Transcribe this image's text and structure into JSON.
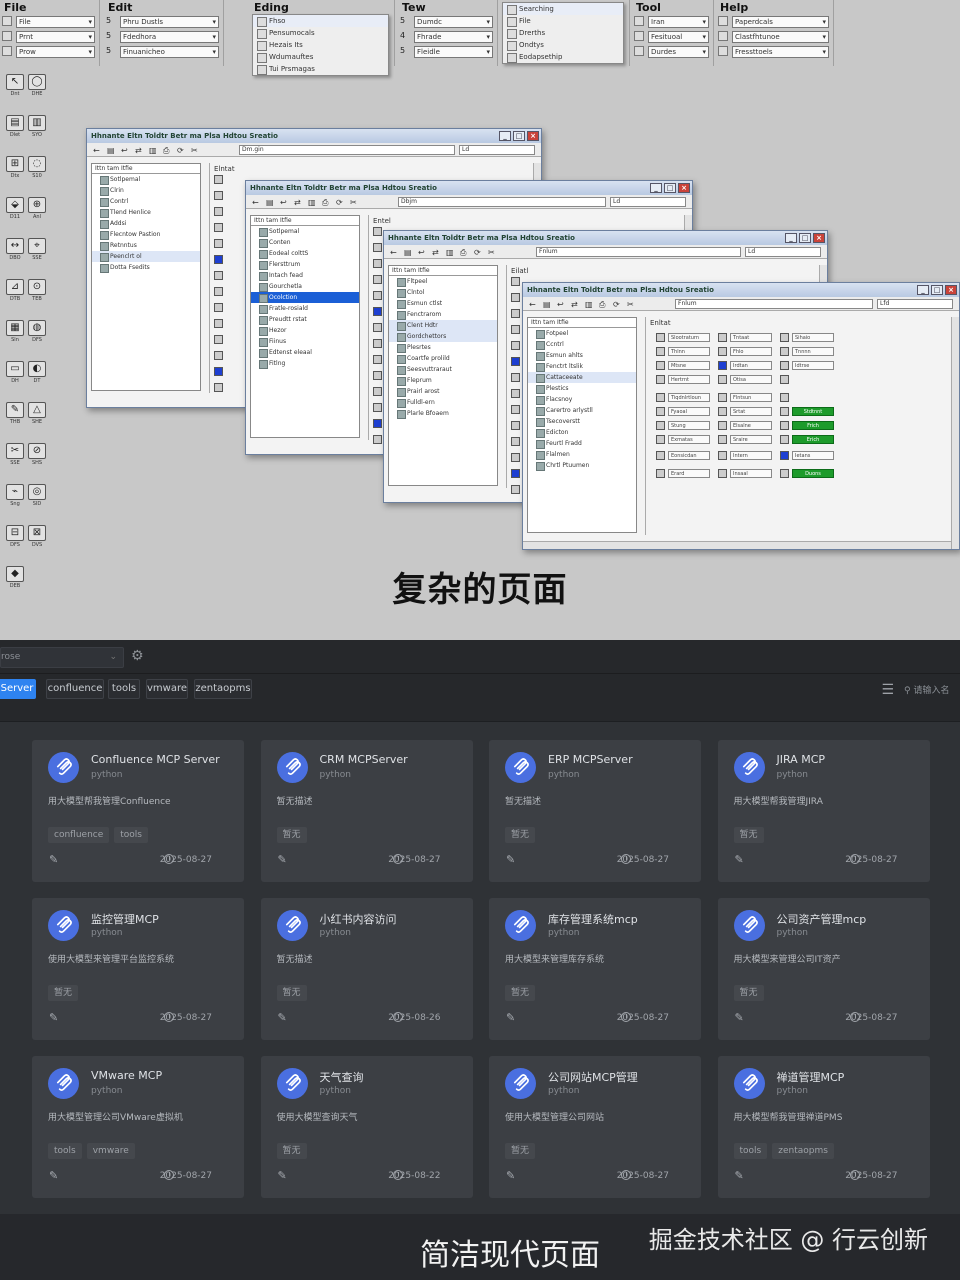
{
  "top": {
    "caption": "复杂的页面",
    "menus": [
      {
        "title": "File",
        "rows": [
          [
            "",
            "File"
          ],
          [
            "",
            "Prnt"
          ],
          [
            "",
            "Prow"
          ]
        ]
      },
      {
        "title": "Edit",
        "rows": [
          [
            "5",
            "Phru Dustls"
          ],
          [
            "5",
            "Fdedhora"
          ],
          [
            "5",
            "Finuanicheo"
          ]
        ]
      },
      {
        "title": "Eding",
        "rows": [
          [
            "",
            "Fhso"
          ],
          [
            "",
            "Pensumocals"
          ],
          [
            "",
            "Hezais Its"
          ],
          [
            "",
            "Wdumauftes"
          ],
          [
            "",
            "Tui Prsmagas"
          ]
        ]
      },
      {
        "title": "Tew",
        "rows": [
          [
            "5",
            "Dumdc"
          ],
          [
            "4",
            "Fhrade"
          ],
          [
            "5",
            "Fleidle"
          ]
        ]
      },
      {
        "title": "",
        "rows": [
          [
            "",
            "Searching"
          ],
          [
            "",
            "File"
          ],
          [
            "",
            "Drerths"
          ],
          [
            "",
            "Ondtys"
          ],
          [
            "",
            "Eodapsethip"
          ]
        ]
      },
      {
        "title": "Tool",
        "rows": [
          [
            "",
            "Iran"
          ],
          [
            "",
            "Fesituoal"
          ],
          [
            "",
            "Durdes"
          ]
        ]
      },
      {
        "title": "Help",
        "rows": [
          [
            "",
            "Paperdcals"
          ],
          [
            "",
            "Clastfhtunoe"
          ],
          [
            "",
            "Fressttoels"
          ]
        ]
      }
    ],
    "windows": [
      {
        "title": "Hhnante  Eltn  Toldtr  Betr ma  Plsa Hdtou  Sreatio",
        "address": "Dm.gin",
        "address2": "Ld",
        "select": "Ittn  tam  Itfie",
        "right_label": "Elntat",
        "tree": [
          "Sotlpemal",
          "Clrin",
          "Contrl",
          "Tlend Henlice",
          "Addsi",
          "Flecntow Pastion",
          "Retnntus",
          "Peenclrt ol",
          "Dotta Fsedits"
        ]
      },
      {
        "title": "Hhnante  Eltn  Toldtr  Betr ma  Plsa Hdtou  Sreatio",
        "address": "Dbjm",
        "address2": "Ld",
        "select": "Ittn  tam  Itfie",
        "right_label": "Entel",
        "tree": [
          "Sotlpemal",
          "Conten",
          "Eodeal colttS",
          "Flersttrum",
          "Intach fead",
          "Gourchetla",
          "Ocolction",
          "Fratle-rosiald",
          "Preudtt rstat",
          "Hezor",
          "Fiinus",
          "Edtenst eleaal",
          "Fitlng"
        ]
      },
      {
        "title": "Hhnante  Eltn  Toldtr  Betr ma  Plsa Hdtou  Sreatio",
        "address": "Fnlum",
        "address2": "Ld",
        "select": "Ittn  tam  Itfie",
        "right_label": "Eilatl",
        "tree": [
          "Fltpeel",
          "Clntol",
          "Esmun ctlst",
          "Fenctrarom",
          "Clent Hdtr",
          "Gordchettors",
          "Plesrtes",
          "Coartfe prolild",
          "Seesvuttraraut",
          "Fleprum",
          "Prairl arost",
          "Fulldl-ern",
          "Plarle Bfoaem"
        ]
      },
      {
        "title": "Hhnante  Eltn  Toldtr  Betr ma  Plsa Hdtou  Sreatio",
        "address": "Fnlum",
        "address2": "Lfd",
        "select": "Ittn  tam  Itfie",
        "right_label": "Enltat",
        "tree": [
          "Fotpeel",
          "Ccntrl",
          "Esmun ahlts",
          "Fenctrt ltslik",
          "Cattaceeate",
          "Plestics",
          "Flacsnoy",
          "Carertro arlystll",
          "Tsecoverstt",
          "Edicton",
          "Feurtl Fradd",
          "Flalmen",
          "Chrtl Ptuumen"
        ]
      }
    ],
    "grid_labels": [
      [
        "Slootraturn",
        "Tntaat",
        "Sihaio"
      ],
      [
        "Thlnn",
        "Fhlo",
        "Tnnnn"
      ],
      [
        "Mtsne",
        "Irdtan",
        "Idtrse"
      ],
      [
        "Hertrnt",
        "Otisa",
        ""
      ],
      [
        "Tiqdnlrtloun",
        "Flntsun",
        ""
      ],
      [
        "Fyaoal",
        "Srtat",
        "Stdtnnt"
      ],
      [
        "Stung",
        "Elsalne",
        "Frich"
      ],
      [
        "Exmatas",
        "Sraire",
        "Erich"
      ],
      [
        "Eonsicdan",
        "Intern",
        "Ietans"
      ],
      [
        "Erard",
        "Insaal",
        "Duons"
      ]
    ],
    "tool_labels": [
      "Dnt",
      "DHE",
      "Dlet",
      "SYO",
      "Dtx",
      "S10",
      "D11",
      "Anl",
      "DBO",
      "SSE",
      "DTB",
      "TEB",
      "Sln",
      "DFS",
      "DH",
      "DT",
      "THB",
      "SHE",
      "SSE",
      "SHS",
      "Sng",
      "SID",
      "DFS",
      "DVS",
      "DEB"
    ]
  },
  "bottom": {
    "user_select": "rose",
    "tabs": [
      {
        "label": "Server",
        "active": true
      },
      {
        "label": "confluence",
        "active": false
      },
      {
        "label": "tools",
        "active": false
      },
      {
        "label": "vmware",
        "active": false
      },
      {
        "label": "zentaopms",
        "active": false
      }
    ],
    "search_placeholder": "请输入名",
    "icons": {
      "settings": "gear-icon",
      "menu": "hamburger-icon",
      "search": "search-icon",
      "edit": "pencil-icon",
      "date": "clock-icon",
      "avatar": "mcp-logo-icon"
    },
    "accent_color": "#2e83f0",
    "avatar_color": "#4a6fe0",
    "cards": [
      {
        "name": "Confluence MCP Server",
        "lang": "python",
        "desc": "用大模型帮我管理Confluence",
        "tags": [
          "confluence",
          "tools"
        ],
        "date": "2025-08-27"
      },
      {
        "name": "CRM MCPServer",
        "lang": "python",
        "desc": "暂无描述",
        "tags": [
          "暂无"
        ],
        "date": "2025-08-27"
      },
      {
        "name": "ERP MCPServer",
        "lang": "python",
        "desc": "暂无描述",
        "tags": [
          "暂无"
        ],
        "date": "2025-08-27"
      },
      {
        "name": "JIRA MCP",
        "lang": "python",
        "desc": "用大模型帮我管理JIRA",
        "tags": [
          "暂无"
        ],
        "date": "2025-08-27"
      },
      {
        "name": "监控管理MCP",
        "lang": "python",
        "desc": "使用大模型来管理平台监控系统",
        "tags": [
          "暂无"
        ],
        "date": "2025-08-27"
      },
      {
        "name": "小红书内容访问",
        "lang": "python",
        "desc": "暂无描述",
        "tags": [
          "暂无"
        ],
        "date": "2025-08-26"
      },
      {
        "name": "库存管理系统mcp",
        "lang": "python",
        "desc": "用大模型来管理库存系统",
        "tags": [
          "暂无"
        ],
        "date": "2025-08-27"
      },
      {
        "name": "公司资产管理mcp",
        "lang": "python",
        "desc": "用大模型来管理公司IT资产",
        "tags": [
          "暂无"
        ],
        "date": "2025-08-27"
      },
      {
        "name": "VMware MCP",
        "lang": "python",
        "desc": "用大模型管理公司VMware虚拟机",
        "tags": [
          "tools",
          "vmware"
        ],
        "date": "2025-08-27"
      },
      {
        "name": "天气查询",
        "lang": "python",
        "desc": "使用大模型查询天气",
        "tags": [
          "暂无"
        ],
        "date": "2025-08-22"
      },
      {
        "name": "公司网站MCP管理",
        "lang": "python",
        "desc": "使用大模型管理公司网站",
        "tags": [
          "暂无"
        ],
        "date": "2025-08-27"
      },
      {
        "name": "禅道管理MCP",
        "lang": "python",
        "desc": "用大模型帮我管理禅道PMS",
        "tags": [
          "tools",
          "zentaopms"
        ],
        "date": "2025-08-27"
      }
    ],
    "caption": "简洁现代页面",
    "watermark": "掘金技术社区 @ 行云创新"
  }
}
